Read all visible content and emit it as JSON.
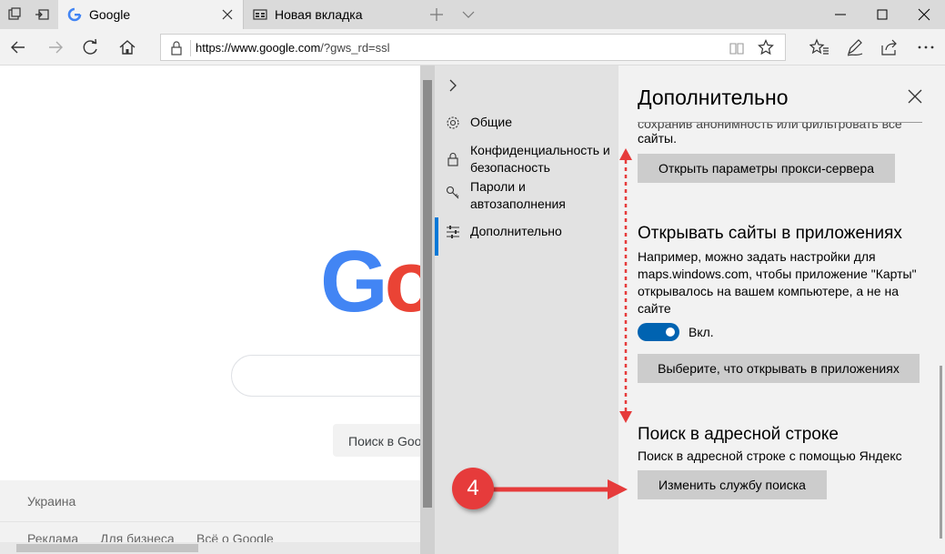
{
  "browser": {
    "tabs": [
      {
        "title": "Google",
        "active": true,
        "favicon": "google-g-icon"
      },
      {
        "title": "Новая вкладка",
        "active": false,
        "favicon": "new-tab-page-icon"
      }
    ],
    "url_host": "https://www.google.com",
    "url_path": "/?gws_rd=ssl",
    "accent": "#0078d7"
  },
  "page": {
    "logo_g": "G",
    "logo_o": "o",
    "search_button": "Поиск в Goo",
    "country": "Украина",
    "footer_links": [
      "Реклама",
      "Для бизнеса",
      "Всё о Google"
    ]
  },
  "sidenav": {
    "items": [
      {
        "label": "Общие",
        "icon": "gear-icon"
      },
      {
        "label": "Конфиденциальность и безопасность",
        "icon": "lock-icon"
      },
      {
        "label": "Пароли и автозаполнения",
        "icon": "key-icon"
      },
      {
        "label": "Дополнительно",
        "icon": "sliders-icon",
        "selected": true
      }
    ]
  },
  "pane": {
    "title": "Дополнительно",
    "cut_text": "сохранив анонимность или фильтровать все",
    "cut_text_end": "сайты.",
    "proxy_button": "Открыть параметры прокси-сервера",
    "apps_heading": "Открывать сайты в приложениях",
    "apps_desc_1": "Например, можно задать настройки для",
    "apps_desc_2": "maps.windows.com, чтобы приложение \"Карты\"",
    "apps_desc_3": "открывалось на  вашем компьютере, а не на",
    "apps_desc_4": "сайте",
    "toggle_label": "Вкл.",
    "toggle_on": true,
    "apps_button": "Выберите, что открывать в приложениях",
    "search_heading": "Поиск в адресной строке",
    "search_desc": "Поиск в адресной строке с помощью Яндекс",
    "search_button": "Изменить службу поиска"
  },
  "annotation": {
    "step_number": "4",
    "color": "#e63b3b"
  }
}
